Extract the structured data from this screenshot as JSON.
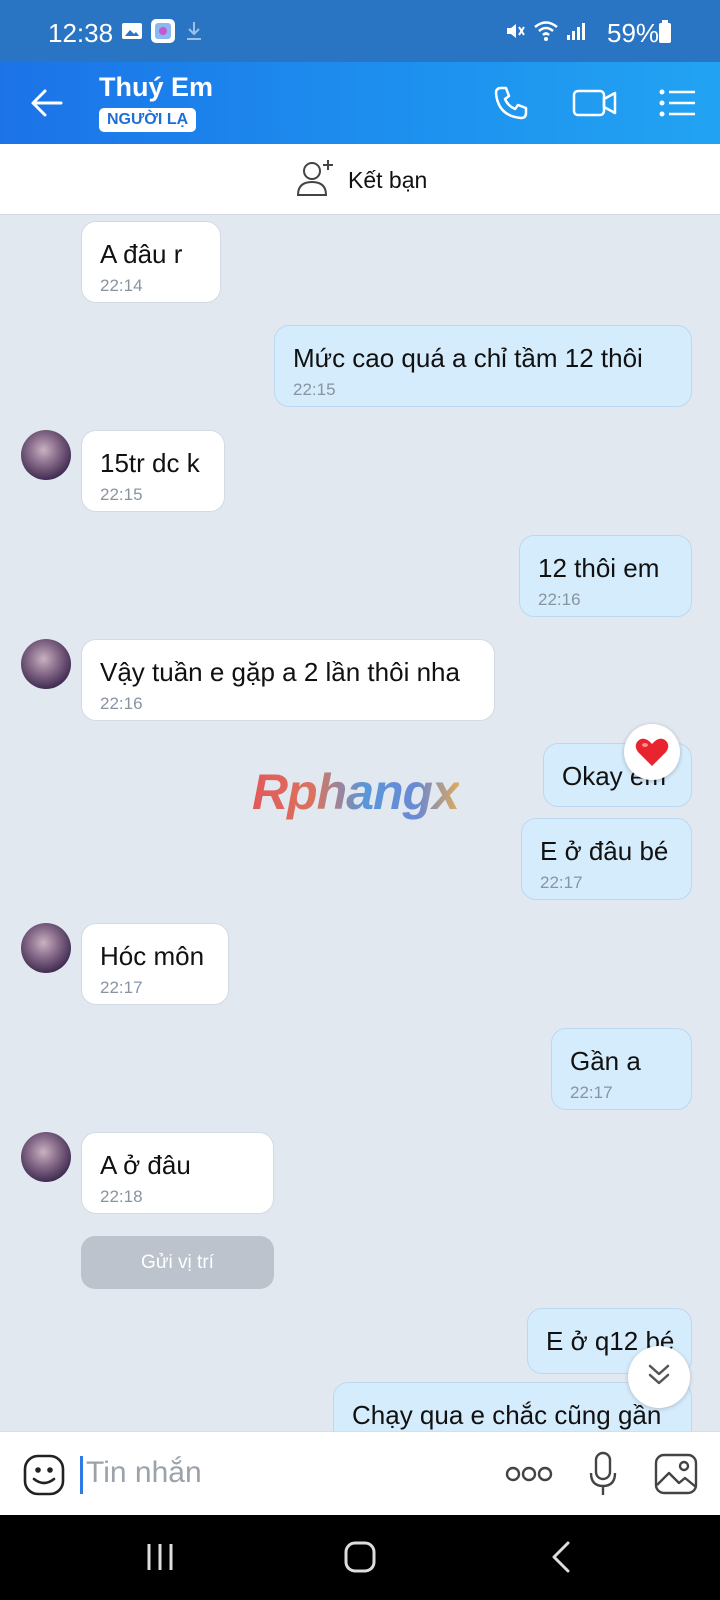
{
  "status": {
    "time": "12:38",
    "battery": "59%"
  },
  "header": {
    "name": "Thuý Em",
    "badge": "NGƯỜI LẠ"
  },
  "add_friend": {
    "label": "Kết bạn"
  },
  "messages": [
    {
      "dir": "in",
      "text": "A đâu r",
      "time": "22:14"
    },
    {
      "dir": "out",
      "text": "Mức cao quá a chỉ tầm 12 thôi",
      "time": "22:15"
    },
    {
      "dir": "in",
      "text": "15tr dc k",
      "time": "22:15"
    },
    {
      "dir": "out",
      "text": "12 thôi em",
      "time": "22:16"
    },
    {
      "dir": "in",
      "text": "Vậy tuần e gặp a 2 lần thôi nha",
      "time": "22:16"
    },
    {
      "dir": "out",
      "text": "Okay em",
      "reaction": "heart"
    },
    {
      "dir": "out",
      "text": "E ở đâu bé",
      "time": "22:17"
    },
    {
      "dir": "in",
      "text": "Hóc môn",
      "time": "22:17"
    },
    {
      "dir": "out",
      "text": "Gần a",
      "time": "22:17"
    },
    {
      "dir": "in",
      "text": "A ở đâu",
      "time": "22:18"
    },
    {
      "dir": "out",
      "text": "E ở q12 bé"
    },
    {
      "dir": "out",
      "text": "Chạy qua e chắc cũng gần"
    }
  ],
  "location_button": "Gửi vị trí",
  "watermark": "Rphangx",
  "input": {
    "placeholder": "Tin nhắn"
  },
  "colors": {
    "header_blue": "#1d92ef",
    "sent_bubble": "#d5ecfc",
    "chat_bg": "#e2e8f0"
  }
}
